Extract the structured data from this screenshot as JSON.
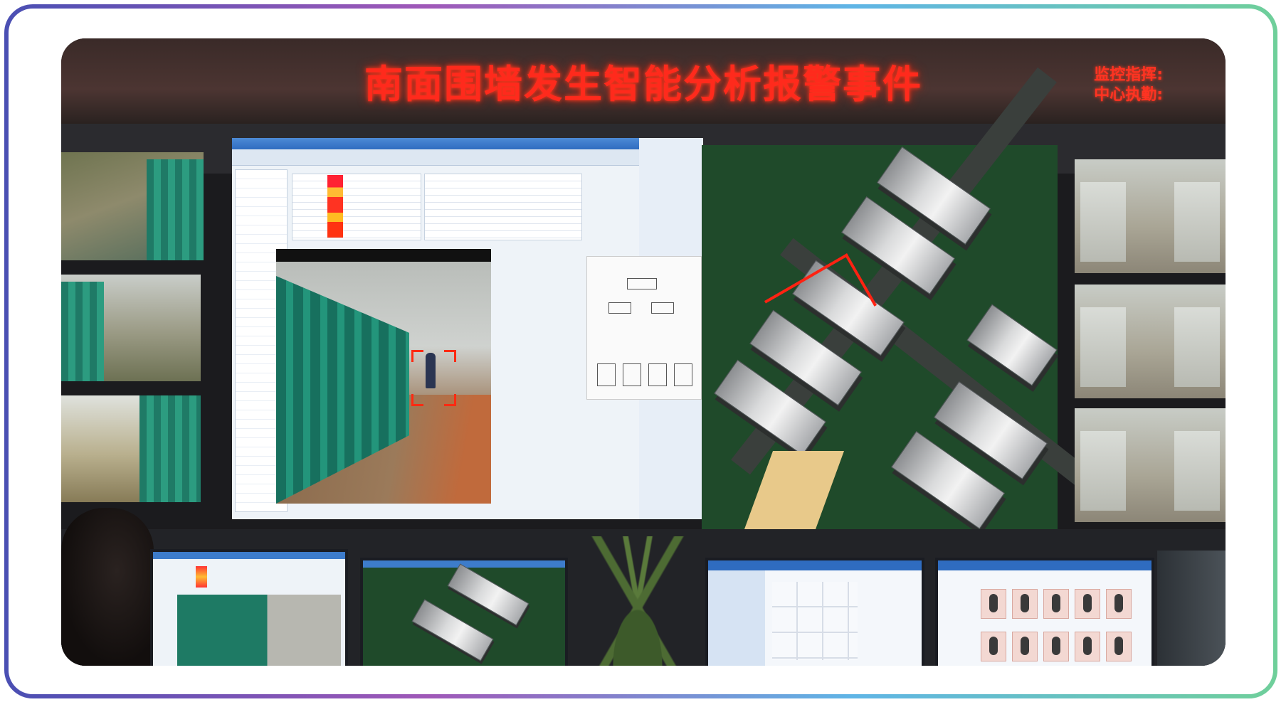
{
  "banner": {
    "title": "南面围墙发生智能分析报警事件",
    "side_line1": "监控指挥:",
    "side_line2": "中心执勤:"
  },
  "colors": {
    "led_text": "#ff2a1c",
    "frame_gradient": [
      "#4a4fb3",
      "#a058b8",
      "#5fb5e6",
      "#6fcf9a"
    ],
    "alarm_red": "#ff2a12",
    "fence_green": "#1f7a66"
  }
}
